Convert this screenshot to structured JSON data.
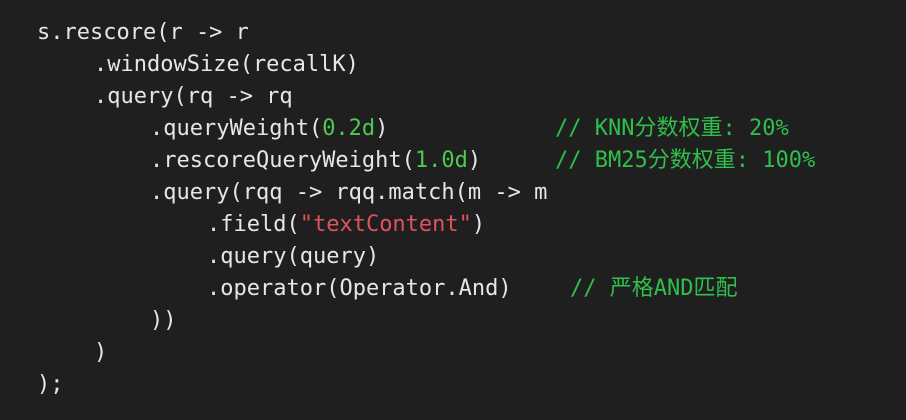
{
  "colors": {
    "background": "#1f1f1f",
    "text": "#e6e6e6",
    "number": "#4ec94e",
    "string": "#e0535c",
    "comment": "#2fbf4b"
  },
  "code": {
    "line1": "s.rescore(r -> r",
    "line2": ".windowSize(recallK)",
    "line3": ".query(rq -> rq",
    "line4_pre": ".queryWeight(",
    "line4_num": "0.2d",
    "line4_post": ")",
    "line4_comment": "// KNN分数权重: 20%",
    "line5_pre": ".rescoreQueryWeight(",
    "line5_num": "1.0d",
    "line5_post": ")",
    "line5_comment": "// BM25分数权重: 100%",
    "line6": ".query(rqq -> rqq.match(m -> m",
    "line7_pre": ".field(",
    "line7_str": "\"textContent\"",
    "line7_post": ")",
    "line8": ".query(query)",
    "line9": ".operator(Operator.And)",
    "line9_comment": "// 严格AND匹配",
    "line10": "))",
    "line11": ")",
    "line12": ");"
  }
}
